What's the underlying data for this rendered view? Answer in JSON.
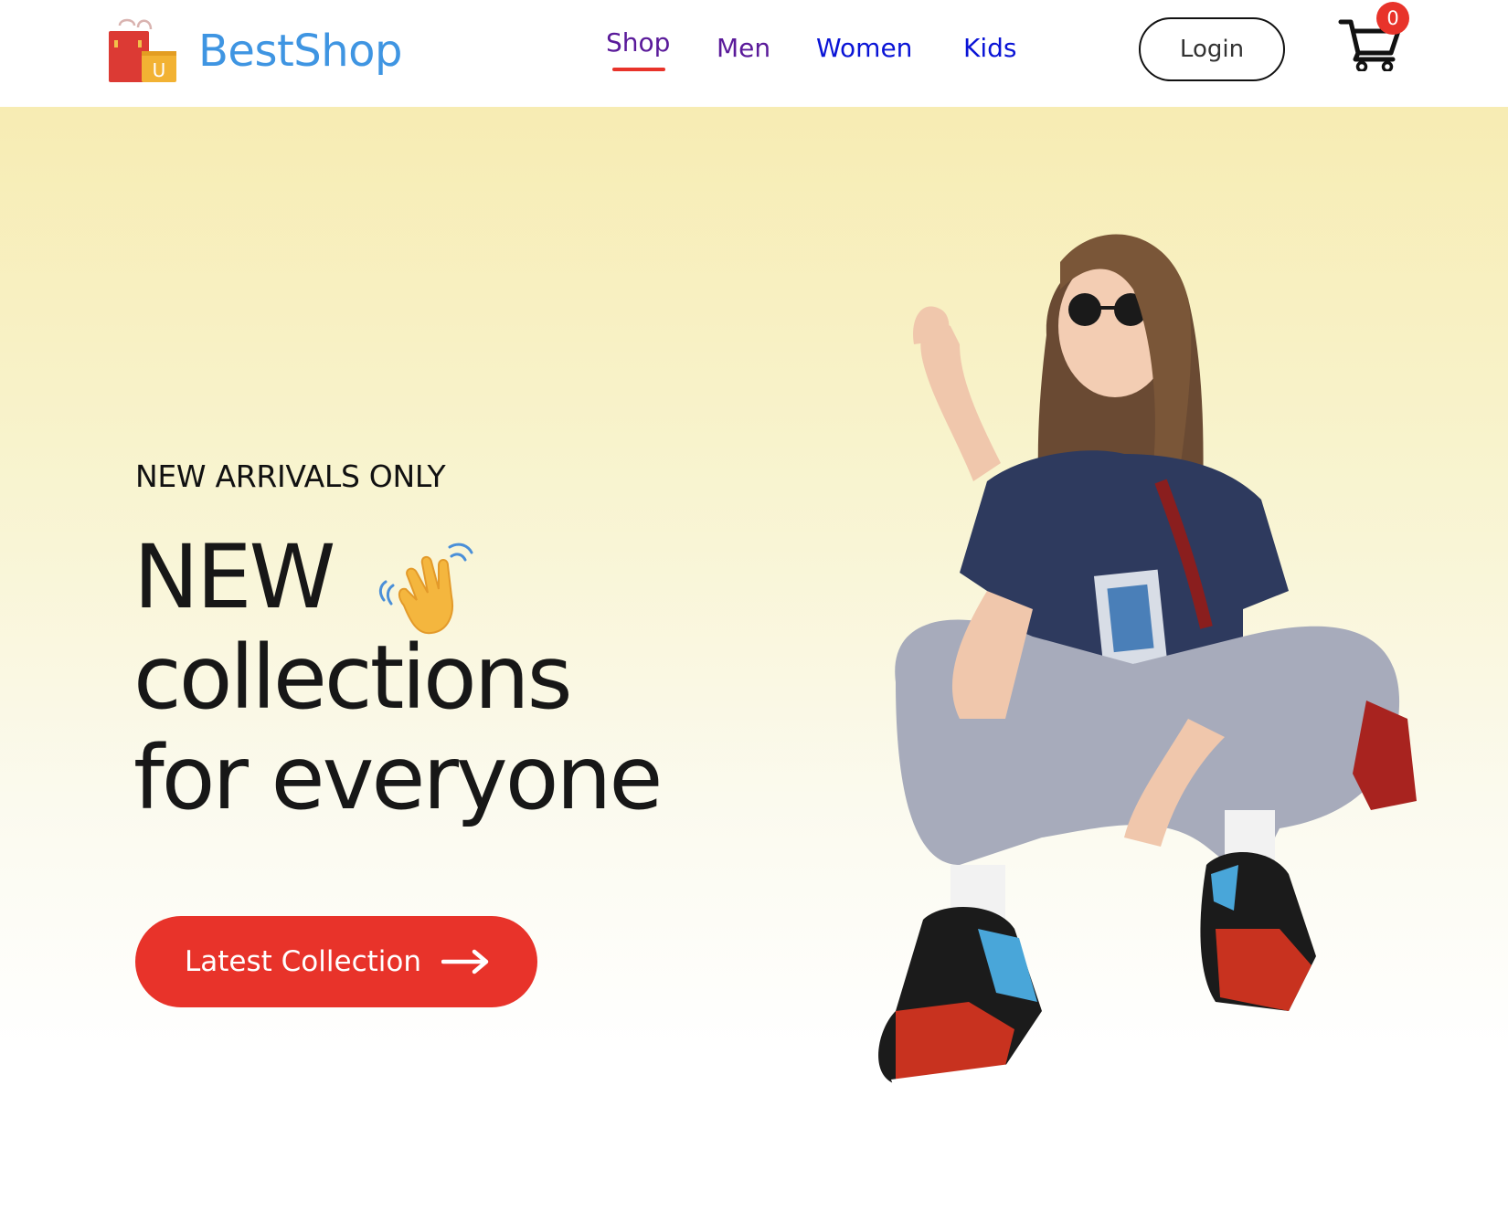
{
  "brand": {
    "name": "BestShop",
    "logo_letter": "U",
    "logo_icon": "shopping-bags-icon",
    "color": "#3f95e2"
  },
  "nav": {
    "items": [
      {
        "label": "Shop",
        "active": true
      },
      {
        "label": "Men",
        "active": false
      },
      {
        "label": "Women",
        "active": false
      },
      {
        "label": "Kids",
        "active": false
      }
    ],
    "active_indicator_color": "#e8332a"
  },
  "header": {
    "login_label": "Login",
    "cart_icon": "cart-icon",
    "cart_count": "0"
  },
  "hero": {
    "eyebrow": "NEW ARRIVALS ONLY",
    "headline_line1": "NEW",
    "headline_line2": "collections",
    "headline_line3": "for everyone",
    "wave_icon": "waving-hand-icon",
    "cta_label": "Latest Collection",
    "cta_icon": "arrow-right-icon",
    "cta_color": "#e8332a",
    "hero_image": "model-photo"
  }
}
